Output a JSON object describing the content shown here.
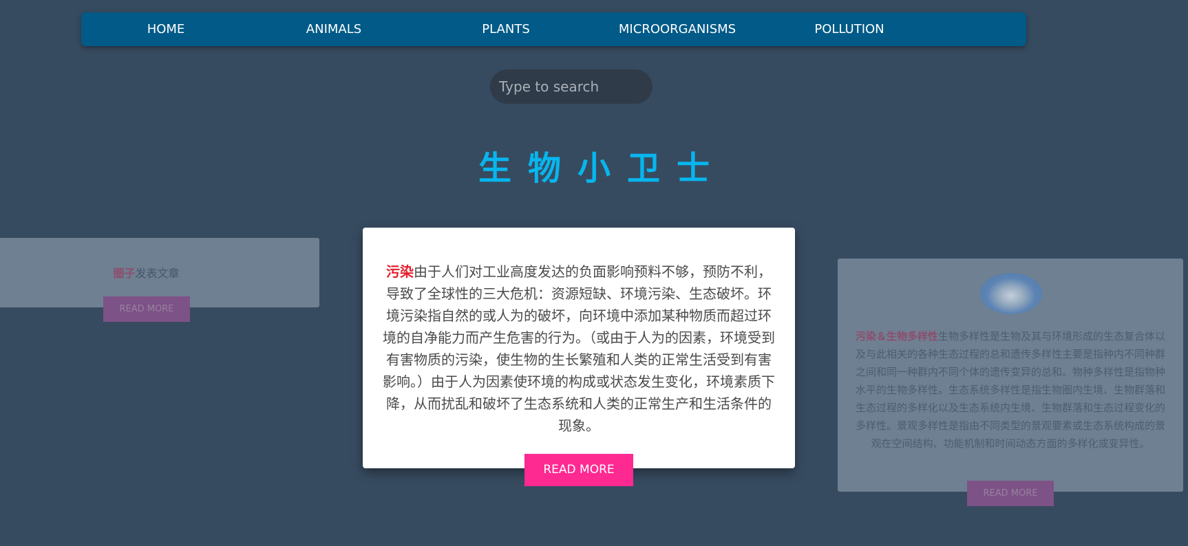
{
  "nav": {
    "items": [
      {
        "label": "HOME"
      },
      {
        "label": "ANIMALS"
      },
      {
        "label": "PLANTS"
      },
      {
        "label": "MICROORGANISMS"
      },
      {
        "label": "POLLUTION"
      }
    ]
  },
  "search": {
    "placeholder": "Type to search"
  },
  "page": {
    "title": "生物小卫士"
  },
  "cards": {
    "left": {
      "highlight": "圈子",
      "text": "发表文章",
      "button": "READ MORE"
    },
    "center": {
      "highlight": "污染",
      "text": "由于人们对工业高度发达的负面影响预料不够，预防不利，导致了全球性的三大危机：资源短缺、环境污染、生态破坏。环境污染指自然的或人为的破坏，向环境中添加某种物质而超过环境的自净能力而产生危害的行为。（或由于人为的因素，环境受到有害物质的污染，使生物的生长繁殖和人类的正常生活受到有害影响。）由于人为因素使环境的构成或状态发生变化，环境素质下降，从而扰乱和破坏了生态系统和人类的正常生产和生活条件的现象。",
      "button": "READ MORE"
    },
    "right": {
      "highlight": "污染＆生物多样性",
      "text": "生物多样性是生物及其与环境形成的生态复合体以及与此相关的各种生态过程的总和遗传多样性主要是指种内不同种群之间和同一种群内不同个体的遗传变异的总和。物种多样性是指物种水平的生物多样性。生态系统多样性是指生物圈内生境、生物群落和生态过程的多样化以及生态系统内生境、生物群落和生态过程变化的多样性。景观多样性是指由不同类型的景观要素或生态系统构成的景观在空间结构、功能机制和时间动态方面的多样化或变异性。",
      "button": "READ MORE"
    }
  },
  "colors": {
    "background": "#374b60",
    "nav": "#015a87",
    "title": "#07b6ee",
    "accent_button": "#ff2992",
    "highlight_red": "#e41e2b"
  }
}
